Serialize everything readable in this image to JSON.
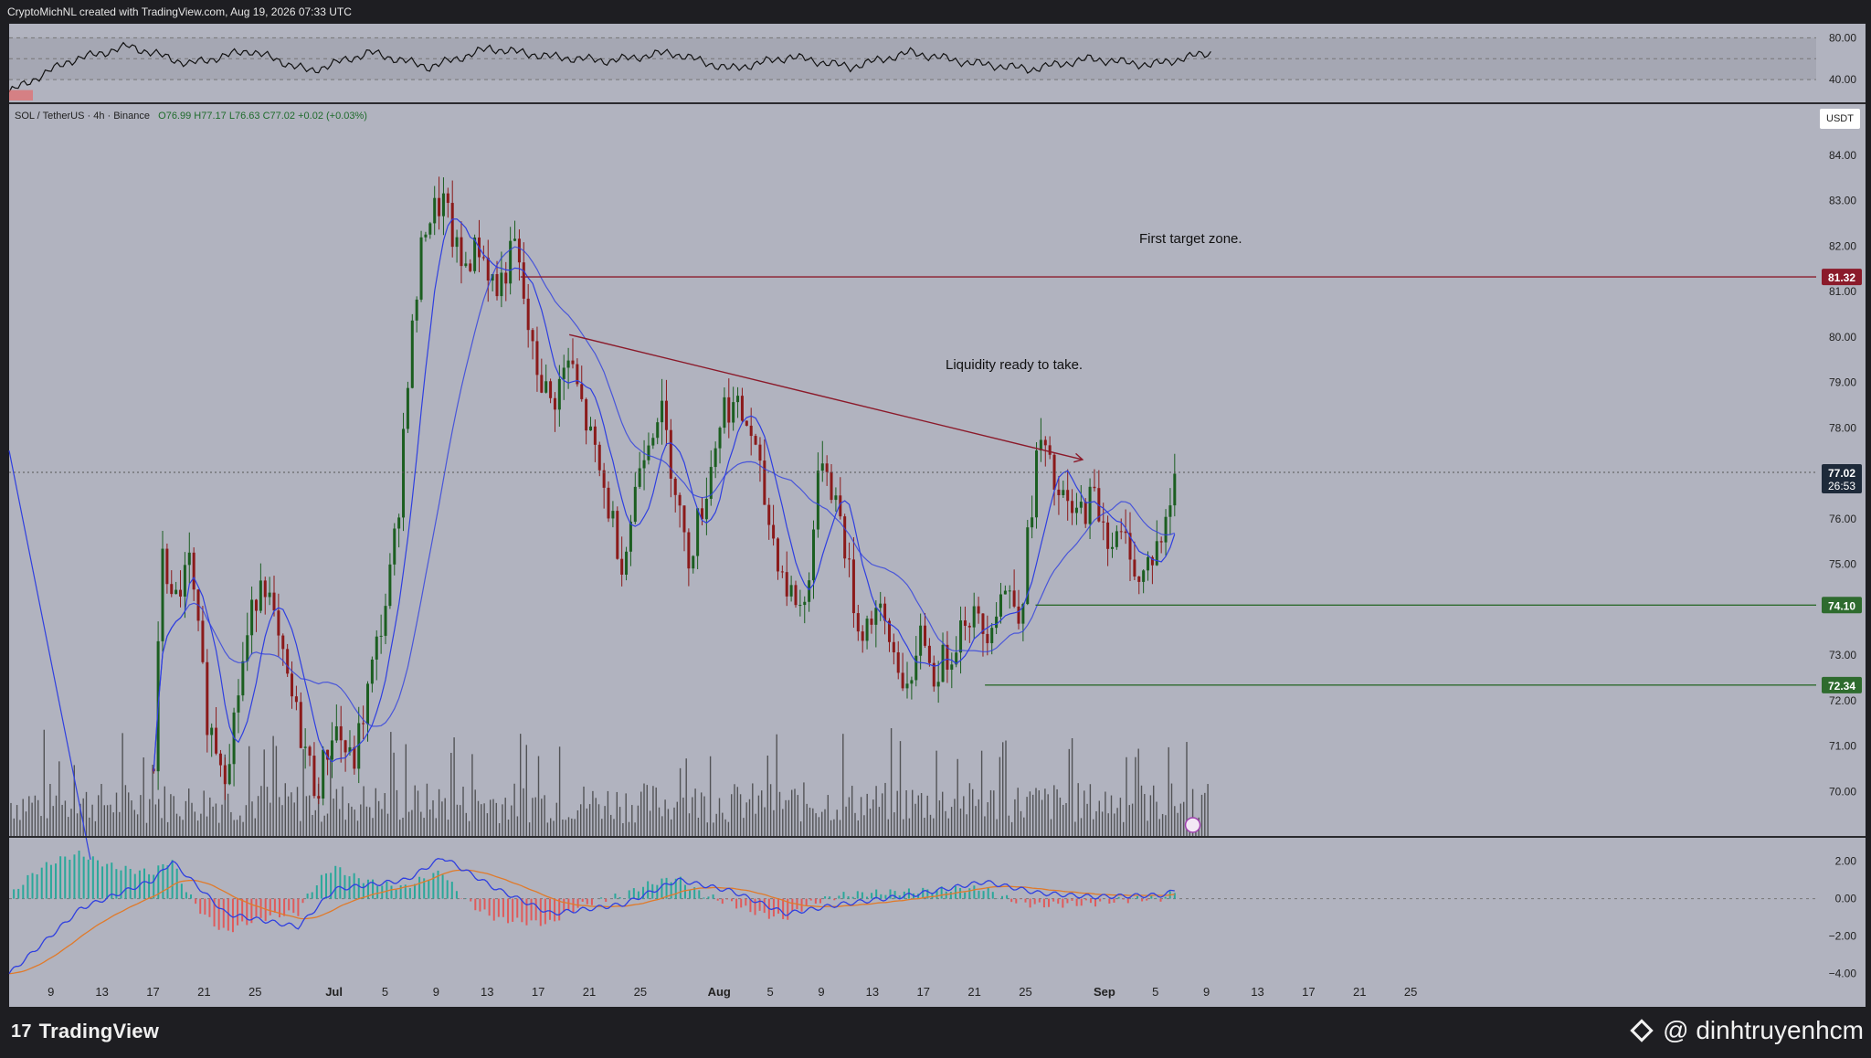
{
  "header": {
    "created_text": "CryptoMichNL created with TradingView.com, Aug 19, 2026 07:33 UTC"
  },
  "legend": {
    "symbol": "SOL / TetherUS · 4h · Binance",
    "open": "O76.99",
    "high": "H77.17",
    "low": "L76.63",
    "close": "C77.02",
    "change": "+0.02 (+0.03%)"
  },
  "currency_badge": "USDT",
  "footer": {
    "brand": "TradingView",
    "watermark": "@ dinhtruyenhcm"
  },
  "colors": {
    "background": "#b1b3bf",
    "bull": "#1b5e20",
    "bear": "#8b1a1a",
    "ma": "#2f3fe0",
    "resistance": "#8b1a2a",
    "support": "#2e6b2e",
    "macd_signal": "#e07a2a"
  },
  "chart_data": [
    {
      "type": "line",
      "name": "RSI",
      "ylim": [
        20,
        90
      ],
      "tick_labels": [
        "80.00",
        "40.00"
      ],
      "x": [
        0,
        0.05,
        0.1,
        0.15,
        0.2,
        0.25,
        0.3,
        0.35,
        0.4,
        0.45,
        0.5,
        0.55,
        0.6,
        0.65,
        0.7,
        0.75,
        0.8,
        0.85,
        0.9,
        0.95,
        1
      ],
      "values": [
        28,
        58,
        72,
        55,
        68,
        48,
        66,
        52,
        70,
        62,
        58,
        66,
        50,
        62,
        52,
        66,
        56,
        50,
        60,
        54,
        66
      ]
    },
    {
      "type": "candlestick",
      "ylim": [
        69.0,
        85.0
      ],
      "price_ticks": [
        "84.00",
        "83.00",
        "82.00",
        "81.00",
        "80.00",
        "79.00",
        "78.00",
        "76.00",
        "75.00",
        "73.00",
        "72.00",
        "71.00",
        "70.00"
      ],
      "x_ticks": [
        "9",
        "13",
        "17",
        "21",
        "25",
        "Jul",
        "5",
        "9",
        "13",
        "17",
        "21",
        "25",
        "Aug",
        "5",
        "9",
        "13",
        "17",
        "21",
        "25",
        "Sep",
        "5",
        "9",
        "13",
        "17",
        "21",
        "25"
      ],
      "ohlc_path": [
        [
          0.08,
          70.5
        ],
        [
          0.085,
          75.5
        ],
        [
          0.09,
          74.0
        ],
        [
          0.1,
          75.0
        ],
        [
          0.11,
          71.5
        ],
        [
          0.12,
          70.5
        ],
        [
          0.13,
          73.0
        ],
        [
          0.14,
          75.0
        ],
        [
          0.15,
          73.0
        ],
        [
          0.16,
          71.5
        ],
        [
          0.17,
          70.0
        ],
        [
          0.18,
          71.5
        ],
        [
          0.19,
          70.5
        ],
        [
          0.2,
          72.5
        ],
        [
          0.21,
          74.5
        ],
        [
          0.215,
          76.0
        ],
        [
          0.22,
          79.0
        ],
        [
          0.23,
          82.5
        ],
        [
          0.24,
          83.0
        ],
        [
          0.25,
          81.5
        ],
        [
          0.26,
          82.0
        ],
        [
          0.27,
          81.0
        ],
        [
          0.28,
          82.0
        ],
        [
          0.29,
          79.5
        ],
        [
          0.3,
          78.5
        ],
        [
          0.31,
          79.5
        ],
        [
          0.32,
          78.0
        ],
        [
          0.33,
          76.5
        ],
        [
          0.34,
          75.0
        ],
        [
          0.35,
          77.5
        ],
        [
          0.36,
          78.5
        ],
        [
          0.37,
          76.5
        ],
        [
          0.375,
          75.0
        ],
        [
          0.385,
          76.5
        ],
        [
          0.395,
          78.5
        ],
        [
          0.4,
          78.5
        ],
        [
          0.41,
          78.0
        ],
        [
          0.42,
          76.0
        ],
        [
          0.43,
          74.5
        ],
        [
          0.44,
          74.0
        ],
        [
          0.45,
          77.5
        ],
        [
          0.46,
          76.0
        ],
        [
          0.47,
          73.5
        ],
        [
          0.48,
          74.0
        ],
        [
          0.49,
          73.0
        ],
        [
          0.5,
          72.0
        ],
        [
          0.505,
          74.0
        ],
        [
          0.51,
          72.5
        ],
        [
          0.52,
          73.0
        ],
        [
          0.53,
          74.0
        ],
        [
          0.54,
          73.5
        ],
        [
          0.55,
          74.5
        ],
        [
          0.56,
          74.0
        ],
        [
          0.565,
          76.0
        ],
        [
          0.57,
          77.8
        ],
        [
          0.58,
          76.5
        ],
        [
          0.59,
          76.0
        ],
        [
          0.6,
          76.5
        ],
        [
          0.61,
          75.5
        ],
        [
          0.62,
          75.5
        ],
        [
          0.625,
          74.5
        ],
        [
          0.63,
          75.0
        ],
        [
          0.64,
          75.8
        ],
        [
          0.645,
          77.0
        ]
      ]
    },
    {
      "type": "macd",
      "ylim": [
        -4.5,
        3.0
      ],
      "tick_labels": [
        "2.00",
        "0.00",
        "−2.00",
        "−4.00"
      ],
      "x": [
        0,
        0.04,
        0.08,
        0.09,
        0.12,
        0.16,
        0.18,
        0.22,
        0.24,
        0.27,
        0.3,
        0.34,
        0.37,
        0.4,
        0.43,
        0.46,
        0.5,
        0.54,
        0.57,
        0.6,
        0.64,
        0.645
      ],
      "macd": [
        -4.0,
        -0.5,
        1.0,
        2.0,
        -0.8,
        -1.5,
        0.5,
        1.0,
        2.2,
        0.5,
        -0.8,
        -0.3,
        1.0,
        0.4,
        -0.8,
        -0.3,
        0.2,
        0.9,
        0.3,
        0.1,
        0.2,
        0.5
      ]
    }
  ],
  "levels": [
    {
      "price": 81.32,
      "label": "81.32"
    },
    {
      "price": 77.02,
      "label": "77.02",
      "countdown": "26:53"
    },
    {
      "price": 74.1,
      "label": "74.10"
    },
    {
      "price": 72.34,
      "label": "72.34"
    }
  ],
  "annotations": [
    "First target zone.",
    "Liquidity ready to take."
  ]
}
